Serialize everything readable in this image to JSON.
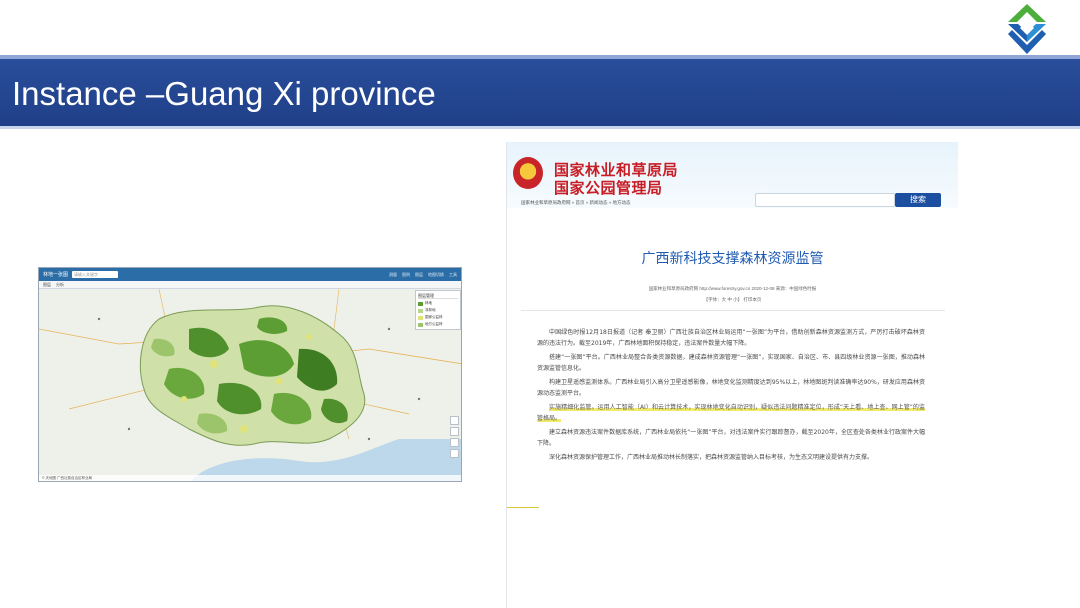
{
  "slide": {
    "title": "Instance –Guang Xi province",
    "brand_colors": {
      "band": "#1f3f88",
      "logo_green": "#4caf3c",
      "logo_blue": "#1f5fb0"
    }
  },
  "map": {
    "brand": "林地一张图",
    "search_placeholder": "请输入关键字",
    "menu": [
      "测量",
      "图例",
      "图层",
      "地图切换",
      "工具"
    ],
    "tabs": [
      "图层",
      "分析"
    ],
    "legend": {
      "header": "图层管理",
      "items": [
        {
          "label": "林地",
          "color": "#5c9e34"
        },
        {
          "label": "非林地",
          "color": "#b6d78a"
        },
        {
          "label": "国家公益林",
          "color": "#e0e37a"
        },
        {
          "label": "地方公益林",
          "color": "#9cc46b"
        }
      ]
    },
    "footer": "© 天地图 广西壮族自治区林业局"
  },
  "article": {
    "org_line1": "国家林业和草原局",
    "org_line2": "国家公园管理局",
    "search_button": "搜索",
    "breadcrumb": "国家林业和草原局政府网 » 首页 » 新闻动态 » 地方动态",
    "title": "广西新科技支撑森林资源监管",
    "meta": "国家林业和草原局政府网 http://www.forestry.gov.cn   2020-12-08   来源：中国绿色时报",
    "meta2": "【字体：大 中 小】   打印本页",
    "paragraphs": [
      "中国绿色时报12月18日报道（记者 秦卫丽）广西壮族自治区林业局运用“一张图”为平台，借助创新森林资源监测方式，严厉打击破坏森林资源的违法行为。截至2019年，广西林地面积保持稳定，违法案件数量大幅下降。",
      "搭建“一张图”平台。广西林业局整合各类资源数据，建成森林资源管理“一张图”，实现国家、自治区、市、县四级林业资源一张图，推动森林资源监管信息化。",
      "构建卫星遥感监测体系。广西林业局引入高分卫星遥感影像，林地变化监测精度达到95%以上，林地图斑判读准确率达90%，研发应用森林资源动态监测平台。",
      "实施精细化监管。运用人工智能（AI）和云计算技术，实现林地变化自动识别，疑似违法问题精准定位，形成“天上看、地上查、网上管”的监管格局。",
      "建立森林资源违法案件数据库系统，广西林业局依托“一张图”平台，对违法案件实行跟踪督办，截至2020年，全区查处各类林业行政案件大幅下降。",
      "深化森林资源保护管理工作，广西林业局推动林长制落实，把森林资源监管纳入目标考核，为生态文明建设提供有力支撑。"
    ]
  }
}
